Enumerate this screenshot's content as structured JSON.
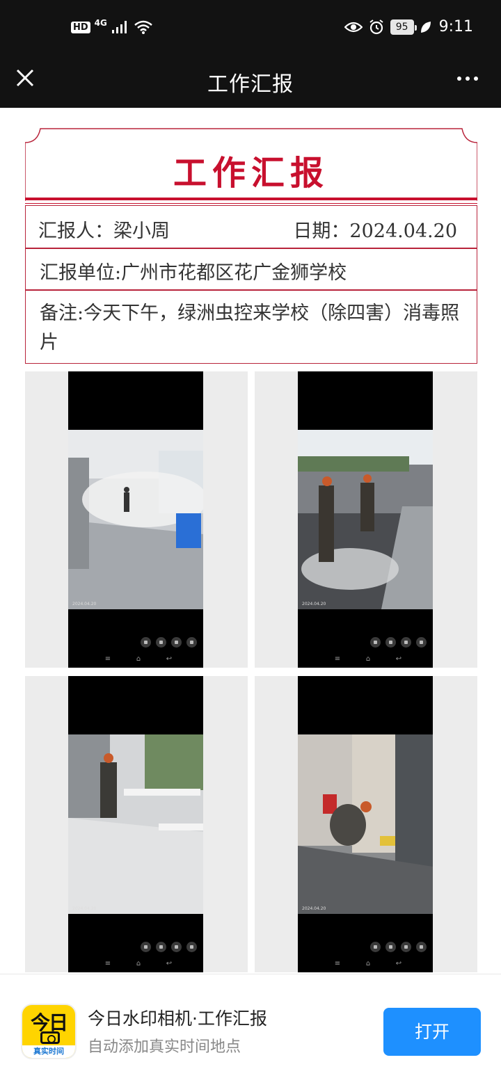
{
  "status_bar": {
    "hd": "HD",
    "network": "4G",
    "battery": "95",
    "time": "9:11",
    "icons": [
      "signal-icon",
      "wifi-icon",
      "eye-icon",
      "alarm-icon",
      "battery-icon",
      "leaf-icon"
    ]
  },
  "title_bar": {
    "title": "工作汇报",
    "close_icon": "close-icon",
    "more_icon": "more-icon"
  },
  "report": {
    "heading": "工作汇报",
    "reporter": "汇报人：梁小周",
    "date": "日期：2024.04.20",
    "unit": "汇报单位:广州市花都区花广金狮学校",
    "note": "备注:今天下午，绿洲虫控来学校（除四害）消毒照片",
    "accent_color": "#c8102e"
  },
  "photos": [
    {
      "watermark": "2024.04.20",
      "scene": "fogging-corridor"
    },
    {
      "watermark": "2024.04.20",
      "scene": "spraying-outdoor"
    },
    {
      "watermark": "2024.04.20",
      "scene": "spraying-canteen"
    },
    {
      "watermark": "2024.04.20",
      "scene": "treating-doorway"
    }
  ],
  "banner": {
    "app_icon_text": "今日",
    "app_icon_strip": "真实时间",
    "title": "今日水印相机·工作汇报",
    "subtitle": "自动添加真实时间地点",
    "open_button": "打开",
    "button_color": "#1e90ff"
  }
}
